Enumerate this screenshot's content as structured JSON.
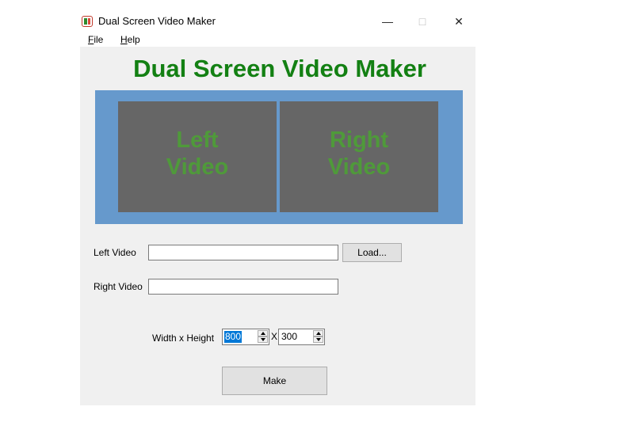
{
  "window": {
    "title": "Dual Screen Video Maker",
    "controls": {
      "minimize": "—",
      "maximize": "□",
      "close": "✕"
    }
  },
  "menu": {
    "file": {
      "mnemonic": "F",
      "rest": "ile"
    },
    "help": {
      "mnemonic": "H",
      "rest": "elp"
    }
  },
  "heading": "Dual Screen Video Maker",
  "preview": {
    "left_line1": "Left",
    "left_line2": "Video",
    "right_line1": "Right",
    "right_line2": "Video",
    "frame_color": "#6699cc",
    "screen_color": "#666666",
    "text_color": "#4f9a3a"
  },
  "form": {
    "left_video_label": "Left Video",
    "left_video_value": "",
    "right_video_label": "Right Video",
    "right_video_value": "",
    "load_button": "Load...",
    "size_label": "Width x Height",
    "width_value": "800",
    "separator": "X",
    "height_value": "300",
    "make_button": "Make"
  },
  "colors": {
    "heading": "#138013",
    "client_bg": "#f0f0f0",
    "selection": "#0078d7"
  }
}
